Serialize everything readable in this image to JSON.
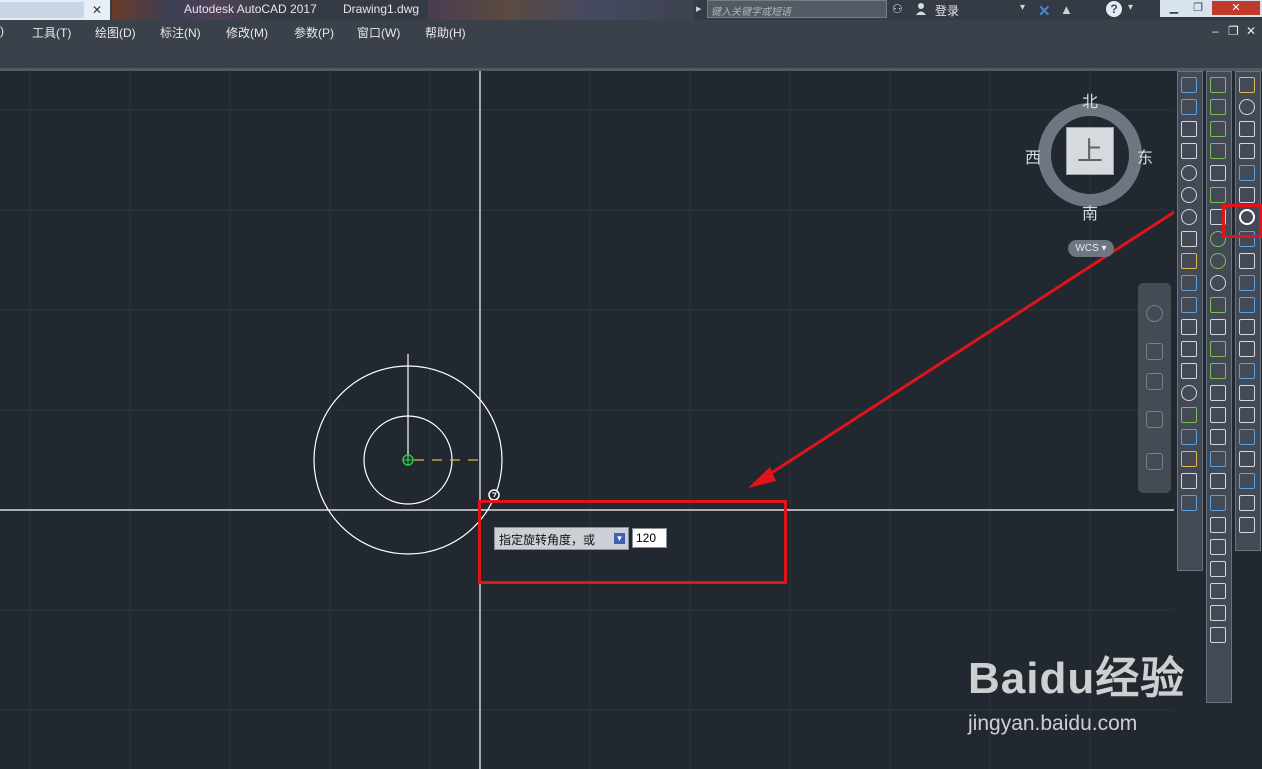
{
  "titlebar": {
    "app_title": "Autodesk AutoCAD 2017",
    "doc_title": "Drawing1.dwg",
    "search_placeholder": "键入关键字或短语",
    "login_label": "登录"
  },
  "menu": {
    "items": [
      ")",
      "工具(T)",
      "绘图(D)",
      "标注(N)",
      "修改(M)",
      "参数(P)",
      "窗口(W)",
      "帮助(H)"
    ]
  },
  "viewcube": {
    "north": "北",
    "south": "南",
    "west": "西",
    "east": "东",
    "face": "上",
    "wcs_label": "WCS"
  },
  "prompt": {
    "label": "指定旋转角度，或",
    "value": "120"
  },
  "watermark": {
    "brand": "Baidu经验",
    "url": "jingyan.baidu.com"
  },
  "icons": {
    "help": "?",
    "search": "binoculars-icon",
    "user": "user-icon",
    "exchange": "x-icon",
    "highlighted_tool": "rotate-icon"
  },
  "colors": {
    "canvas": "#212830",
    "annotation": "#e0141a",
    "crosshair": "#ffffff",
    "track": "#e0b84a",
    "snap": "#27c93f"
  }
}
